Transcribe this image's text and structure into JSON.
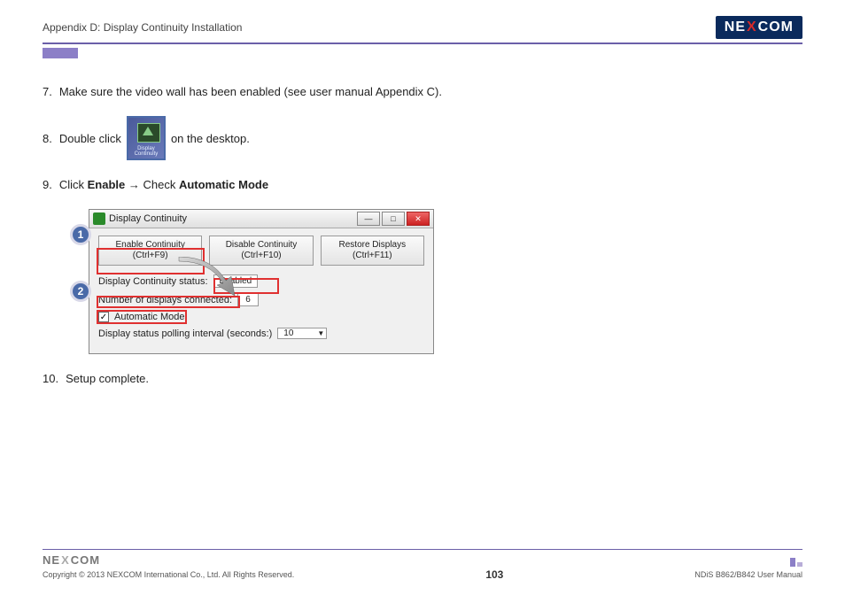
{
  "header": {
    "title": "Appendix D: Display Continuity Installation",
    "logo": {
      "pre": "NE",
      "x": "X",
      "post": "COM"
    }
  },
  "steps": {
    "s7": {
      "num": "7.",
      "text": "Make sure the video wall has been enabled (see user manual Appendix C)."
    },
    "s8": {
      "num": "8.",
      "before": "Double click",
      "after": "on the desktop.",
      "icon_label1": "Display",
      "icon_label2": "Continuity"
    },
    "s9": {
      "num": "9.",
      "text_a": "Click ",
      "bold_a": "Enable",
      "arrow": " → ",
      "text_b": "Check ",
      "bold_b": "Automatic Mode"
    },
    "s10": {
      "num": "10.",
      "text": "Setup complete."
    }
  },
  "window": {
    "title": "Display Continuity",
    "btn_enable": "Enable Continuity\n(Ctrl+F9)",
    "btn_enable_l1": "Enable Continuity",
    "btn_enable_l2": "(Ctrl+F9)",
    "btn_disable_l1": "Disable Continuity",
    "btn_disable_l2": "(Ctrl+F10)",
    "btn_restore_l1": "Restore Displays",
    "btn_restore_l2": "(Ctrl+F11)",
    "status_label": "Display Continuity status:",
    "status_value": "Enabled",
    "num_label": "Number of displays connected:",
    "num_value": "6",
    "auto_label": "Automatic Mode",
    "auto_check": "✓",
    "poll_label": "Display status polling interval (seconds:)",
    "poll_value": "10",
    "min": "—",
    "max": "□",
    "close": "✕"
  },
  "callouts": {
    "c1": "1",
    "c2": "2"
  },
  "footer": {
    "logo": {
      "pre": "NE",
      "x": "X",
      "post": "COM"
    },
    "copyright": "Copyright © 2013 NEXCOM International Co., Ltd. All Rights Reserved.",
    "page": "103",
    "doc": "NDiS B862/B842 User Manual"
  }
}
